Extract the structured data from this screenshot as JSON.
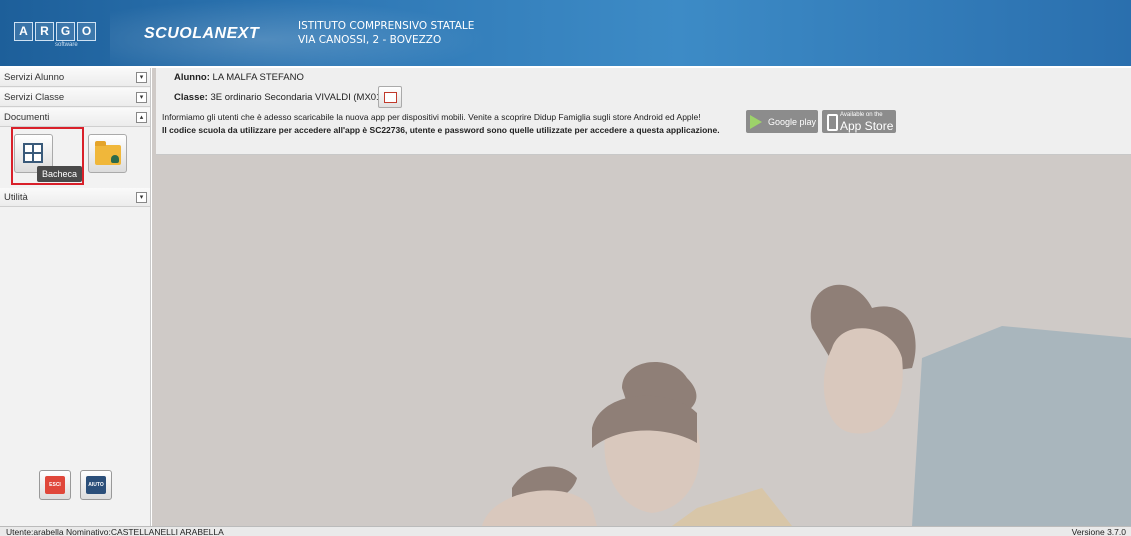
{
  "header": {
    "logo_letters": [
      "A",
      "R",
      "G",
      "O"
    ],
    "logo_sub": "software",
    "brand": "SCUOLANEXT",
    "school_name": "ISTITUTO COMPRENSIVO STATALE",
    "school_address": "VIA CANOSSI, 2 - BOVEZZO"
  },
  "sidebar": {
    "menu": [
      "Servizi Alunno",
      "Servizi Classe",
      "Documenti",
      "Utilità"
    ],
    "tooltip": "Bacheca",
    "esci": "ESCI",
    "aiuto": "AIUTO"
  },
  "main": {
    "alunno_label": "Alunno:",
    "alunno_value": "LA MALFA STEFANO",
    "classe_label": "Classe:",
    "classe_value": "3E ordinario Secondaria VIVALDI (MX01)",
    "notice_line1": "Informiamo gli utenti che è adesso scaricabile la nuova app per dispositivi mobili. Venite a scoprire Didup Famiglia sugli store Android ed Apple!",
    "notice_line2": "Il codice scuola da utilizzare per accedere all'app è SC22736, utente e password sono quelle utilizzate per accedere a questa applicazione.",
    "google_play": "Google play",
    "app_store_small": "Available on the",
    "app_store": "App Store"
  },
  "footer": {
    "user_info": "Utente:arabella Nominativo:CASTELLANELLI ARABELLA",
    "version": "Versione 3.7.0"
  },
  "colors": {
    "header": "#2f78b5",
    "highlight": "#d9202a",
    "esci": "#e0473a",
    "aiuto": "#2b4f7a"
  }
}
